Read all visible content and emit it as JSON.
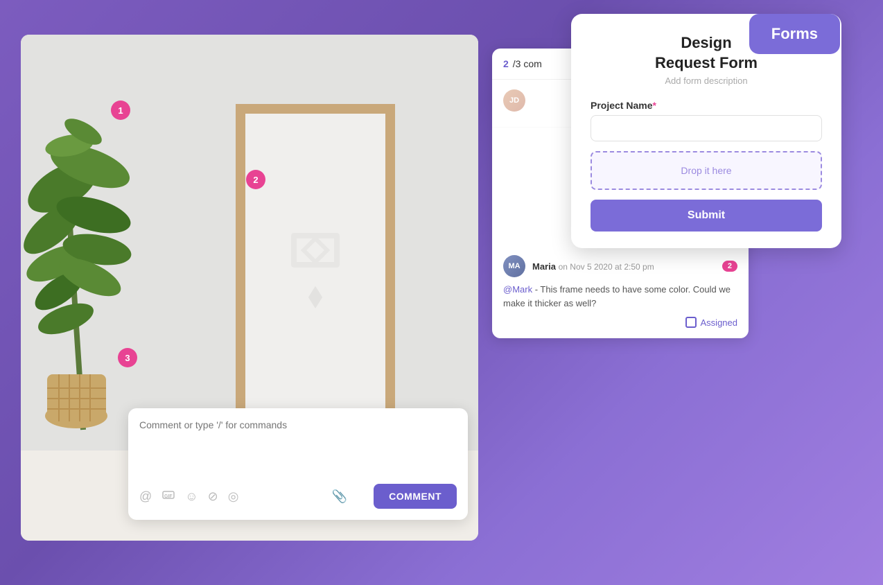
{
  "page": {
    "background": "#7c5cbf"
  },
  "canvas": {
    "pins": [
      {
        "id": "1",
        "label": "1"
      },
      {
        "id": "2",
        "label": "2"
      },
      {
        "id": "3",
        "label": "3"
      }
    ]
  },
  "comment_box": {
    "placeholder": "Comment or type '/' for commands",
    "button_label": "COMMENT",
    "icons": [
      "@",
      "😊",
      "😃",
      "⊘",
      "⊙",
      "📎"
    ]
  },
  "right_panel": {
    "header_count": "2",
    "header_total": "/3 com",
    "comments": [
      {
        "avatar_initials": "JD",
        "username": "Maria",
        "timestamp": "on Nov 5 2020 at 2:50 pm",
        "reply_count": "2",
        "mention": "@Mark",
        "text": " - This frame needs to have some color. Could we make it thicker as well?",
        "assigned_label": "Assigned"
      }
    ]
  },
  "form_panel": {
    "title": "Design\nRequest Form",
    "description": "Add form description",
    "field_label": "Project Name",
    "field_required": "*",
    "drop_label": "Drop it here",
    "submit_label": "Submit"
  },
  "forms_badge": {
    "label": "Forms"
  }
}
